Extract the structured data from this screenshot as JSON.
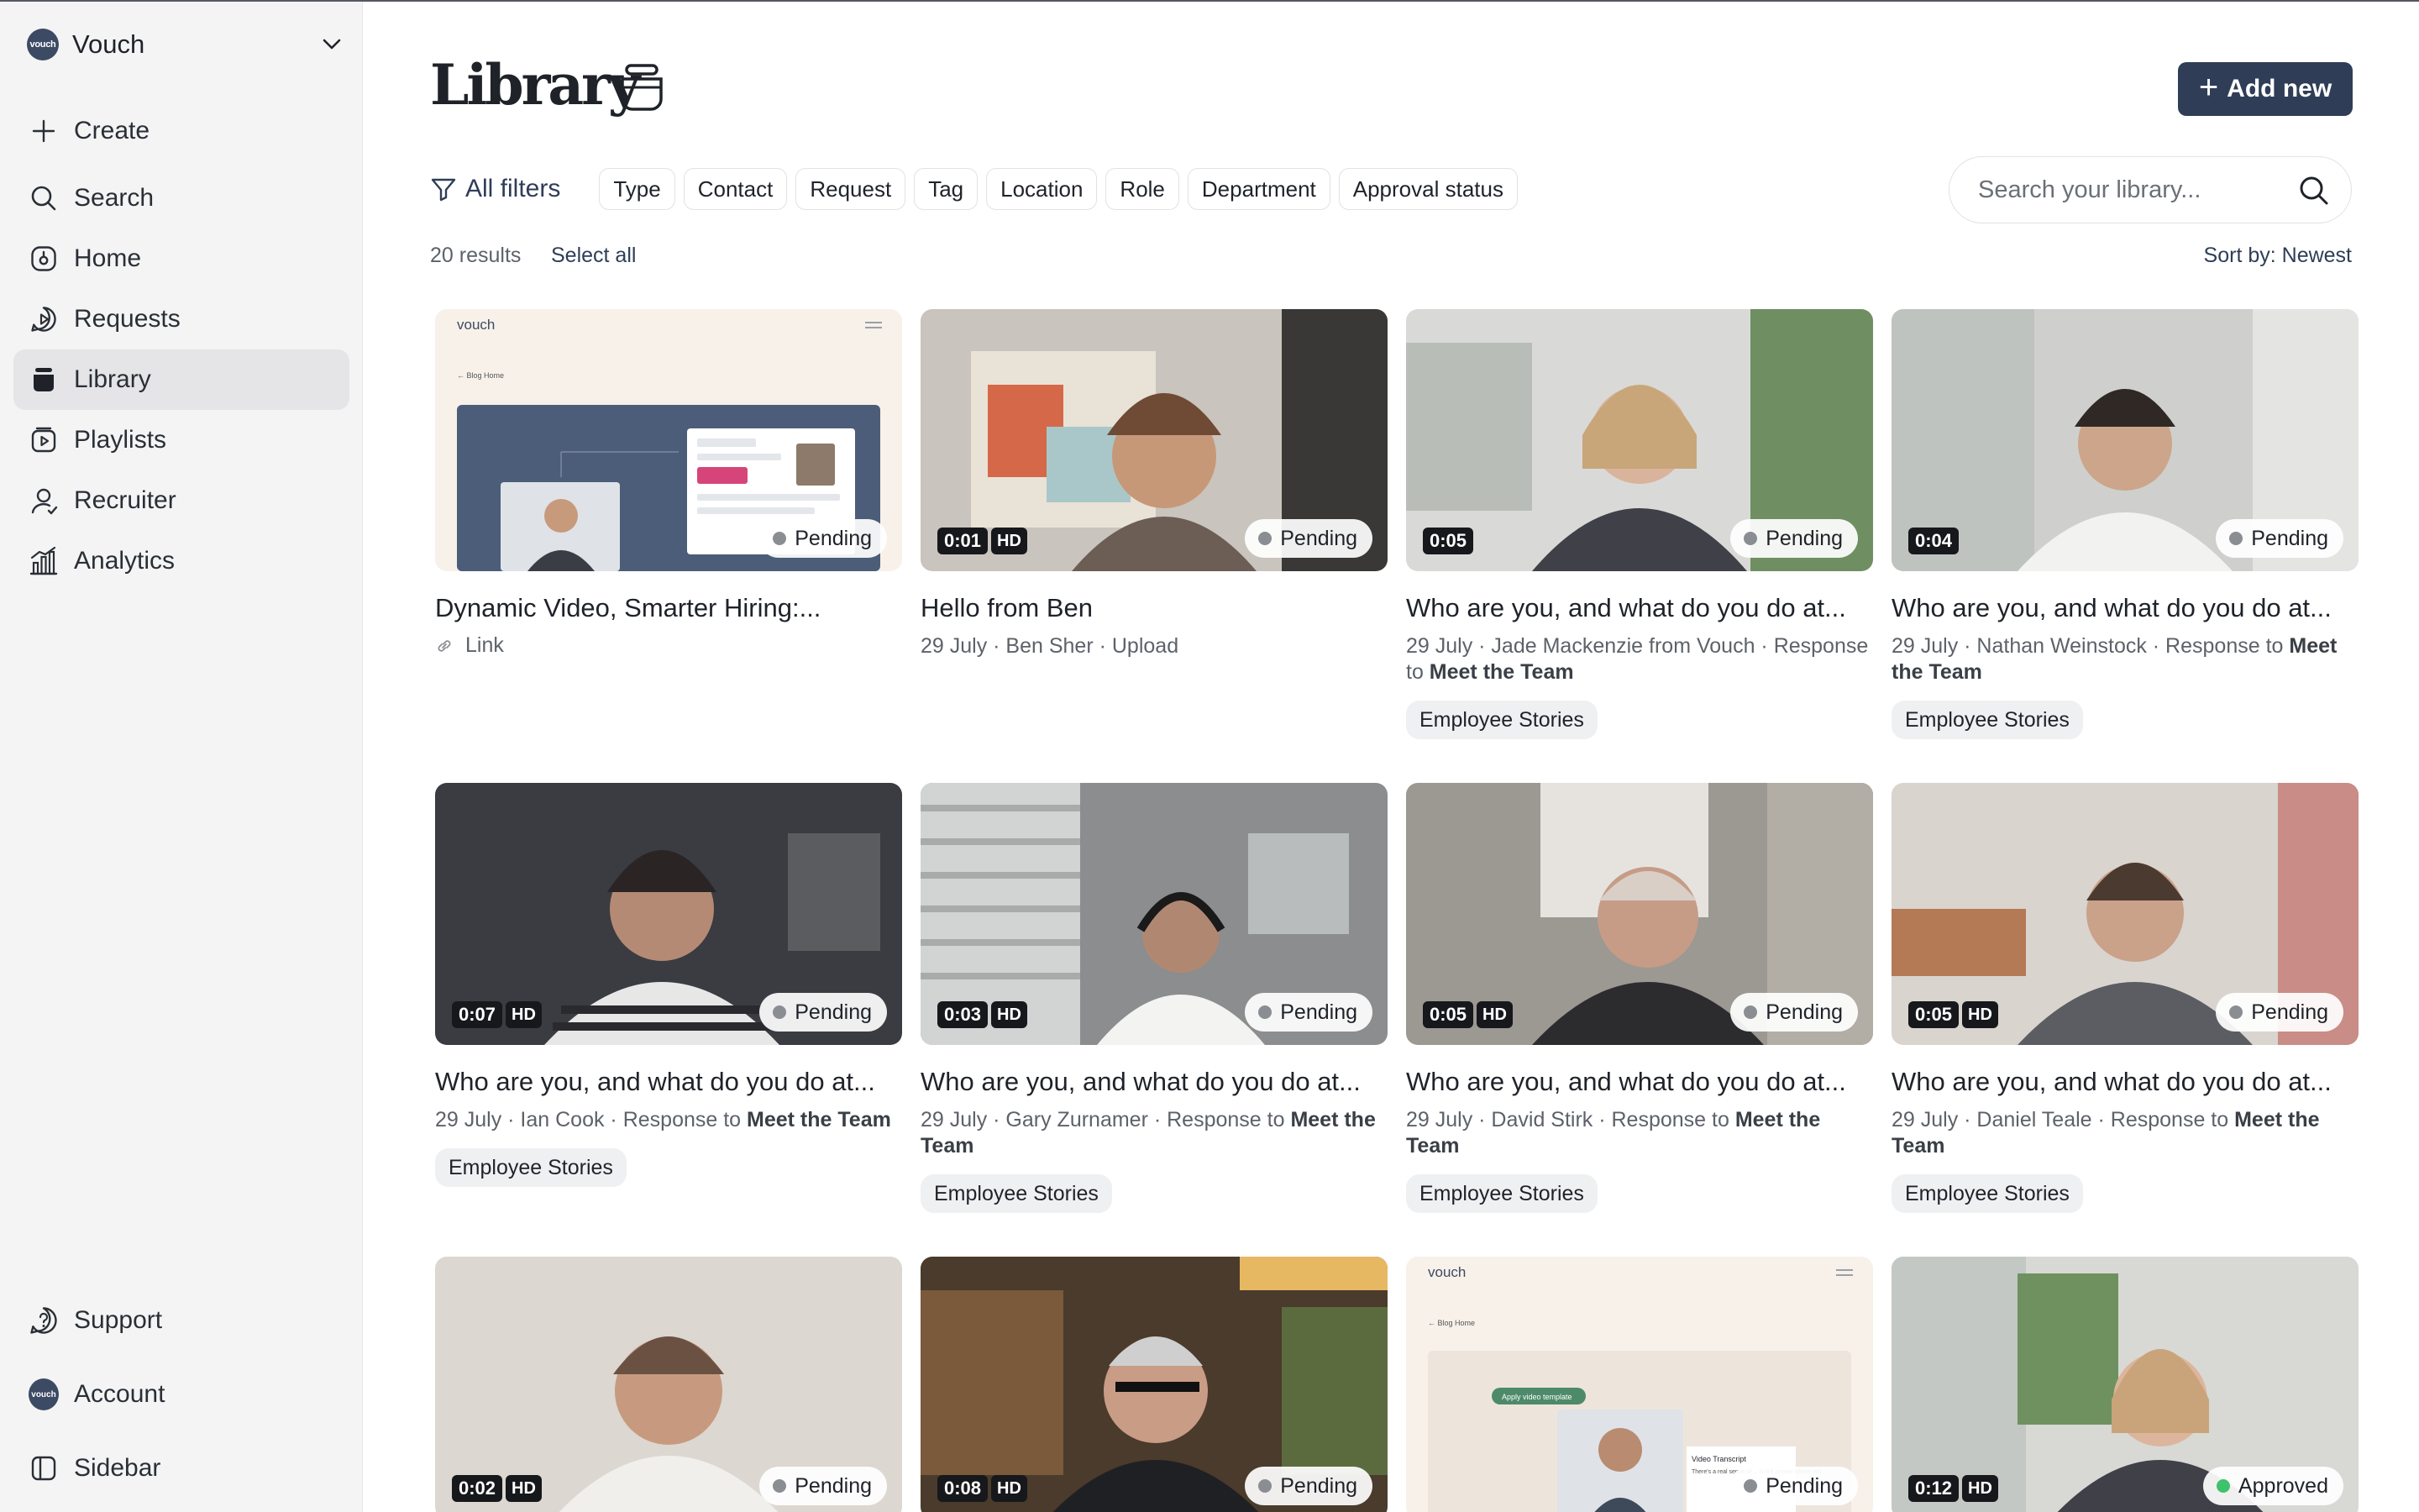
{
  "sidebar": {
    "workspace": {
      "logo": "vouch",
      "name": "Vouch"
    },
    "nav": [
      {
        "label": "Create",
        "icon": "plus-icon"
      },
      {
        "label": "Search",
        "icon": "search-icon"
      },
      {
        "label": "Home",
        "icon": "home-icon"
      },
      {
        "label": "Requests",
        "icon": "requests-icon"
      },
      {
        "label": "Library",
        "icon": "library-icon",
        "active": true
      },
      {
        "label": "Playlists",
        "icon": "playlists-icon"
      },
      {
        "label": "Recruiter",
        "icon": "recruiter-icon"
      },
      {
        "label": "Analytics",
        "icon": "analytics-icon"
      }
    ],
    "bottom": [
      {
        "label": "Support",
        "icon": "help-icon"
      },
      {
        "label": "Account",
        "icon": "account-avatar"
      },
      {
        "label": "Sidebar",
        "icon": "sidebar-toggle-icon"
      }
    ]
  },
  "header": {
    "title": "Library",
    "add_label": "Add new"
  },
  "filters": {
    "all_label": "All filters",
    "chips": [
      "Type",
      "Contact",
      "Request",
      "Tag",
      "Location",
      "Role",
      "Department",
      "Approval status"
    ]
  },
  "search": {
    "placeholder": "Search your library..."
  },
  "results": {
    "count_label": "20 results",
    "select_all": "Select all",
    "sort_label": "Sort by: Newest"
  },
  "colors": {
    "accent": "#2f3d57",
    "pending_dot": "#8a8d92",
    "approved_dot": "#3ec26b"
  },
  "cards": [
    {
      "title": "Dynamic Video, Smarter Hiring:...",
      "meta": "Link",
      "status": "Pending",
      "duration": "",
      "hd": false,
      "tag": ""
    },
    {
      "title": "Hello from Ben",
      "meta": "29 July · Ben Sher · Upload",
      "status": "Pending",
      "duration": "0:01",
      "hd": true,
      "tag": ""
    },
    {
      "title": "Who are you, and what do you do at...",
      "meta_prefix": "29 July · Jade Mackenzie from Vouch · Response to ",
      "meta_bold": "Meet the Team",
      "status": "Pending",
      "duration": "0:05",
      "hd": false,
      "tag": "Employee Stories"
    },
    {
      "title": "Who are you, and what do you do at...",
      "meta_prefix": "29 July · Nathan Weinstock · Response to ",
      "meta_bold": "Meet the Team",
      "status": "Pending",
      "duration": "0:04",
      "hd": false,
      "tag": "Employee Stories"
    },
    {
      "title": "Who are you, and what do you do at...",
      "meta_prefix": "29 July · Ian Cook · Response to ",
      "meta_bold": "Meet the Team",
      "status": "Pending",
      "duration": "0:07",
      "hd": true,
      "tag": "Employee Stories"
    },
    {
      "title": "Who are you, and what do you do at...",
      "meta_prefix": "29 July · Gary Zurnamer · Response to ",
      "meta_bold": "Meet the Team",
      "status": "Pending",
      "duration": "0:03",
      "hd": true,
      "tag": "Employee Stories"
    },
    {
      "title": "Who are you, and what do you do at...",
      "meta_prefix": "29 July · David Stirk · Response to ",
      "meta_bold": "Meet the Team",
      "status": "Pending",
      "duration": "0:05",
      "hd": true,
      "tag": "Employee Stories"
    },
    {
      "title": "Who are you, and what do you do at...",
      "meta_prefix": "29 July · Daniel Teale · Response to ",
      "meta_bold": "Meet the Team",
      "status": "Pending",
      "duration": "0:05",
      "hd": true,
      "tag": "Employee Stories"
    },
    {
      "title": "",
      "status": "Pending",
      "duration": "0:02",
      "hd": true
    },
    {
      "title": "",
      "status": "Pending",
      "duration": "0:08",
      "hd": true
    },
    {
      "title": "",
      "status": "Pending",
      "duration": "",
      "hd": false
    },
    {
      "title": "",
      "status": "Approved",
      "duration": "0:12",
      "hd": true
    }
  ],
  "thumb_text": {
    "brand": "vouch",
    "blog_home": "← Blog Home",
    "template_btn": "Apply video template",
    "transcript_title": "Video Transcript",
    "transcript_body": "There's a real sense of ... to tell people where you"
  }
}
